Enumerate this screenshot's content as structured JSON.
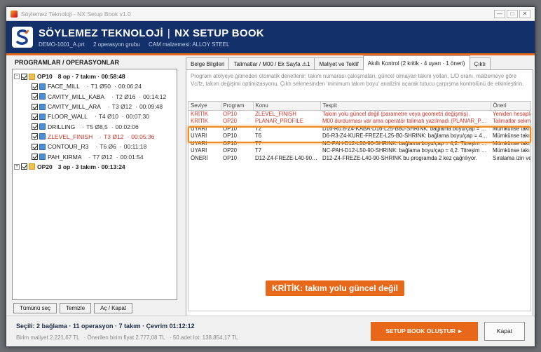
{
  "window": {
    "title": "Söylemez Teknoloji - NX Setup Book v1.0",
    "controls": {
      "minimize": "—",
      "maximize": "□",
      "close": "✕"
    }
  },
  "header": {
    "company": "SÖYLEMEZ TEKNOLOJİ",
    "separator": "|",
    "product": "NX SETUP BOOK",
    "file": "DEMO-1001_A.prt",
    "groups": "2 operasyon grubu",
    "material": "CAM malzemesi: ALLOY STEEL",
    "colors": {
      "header_bg": "#14306a",
      "accent": "#e8681a"
    }
  },
  "left": {
    "title": "PROGRAMLAR / OPERASYONLAR",
    "groups": [
      {
        "expander": "-",
        "name": "OP10",
        "summary": "8 op · 7 takım · 00:58:48",
        "ops": [
          {
            "name": "FACE_MILL",
            "tool": "T1 Ø50",
            "time": "00:06:24",
            "warn": false
          },
          {
            "name": "CAVITY_MILL_KABA",
            "tool": "T2 Ø16",
            "time": "00:14:12",
            "warn": false
          },
          {
            "name": "CAVITY_MILL_ARA",
            "tool": "T3 Ø12",
            "time": "00:09:48",
            "warn": false
          },
          {
            "name": "FLOOR_WALL",
            "tool": "T4 Ø10",
            "time": "00:07:30",
            "warn": false
          },
          {
            "name": "DRILLING",
            "tool": "T5 Ø8,5",
            "time": "00:02:06",
            "warn": false
          },
          {
            "name": "ZLEVEL_FINISH",
            "tool": "T3 Ø12",
            "time": "00:05:36",
            "warn": true
          },
          {
            "name": "CONTOUR_R3",
            "tool": "T6 Ø6",
            "time": "00:11:18",
            "warn": false
          },
          {
            "name": "PAH_KIRMA",
            "tool": "T7 Ø12",
            "time": "00:01:54",
            "warn": false
          }
        ]
      },
      {
        "expander": "+",
        "name": "OP20",
        "summary": "3 op · 3 takım · 00:13:24",
        "ops": []
      }
    ],
    "buttons": {
      "select_all": "Tümünü seç",
      "clear": "Temizle",
      "toggle": "Aç / Kapat"
    }
  },
  "tabs": [
    {
      "label": "Belge Bilgileri",
      "active": false
    },
    {
      "label": "Talimatlar / M00 / Ek Sayfa ⚠1",
      "active": false
    },
    {
      "label": "Maliyet ve Teklif",
      "active": false
    },
    {
      "label": "Akıllı Kontrol  (2 kritik · 4 uyarı · 1 öneri)",
      "active": true
    },
    {
      "label": "Çıktı",
      "active": false
    }
  ],
  "check": {
    "description": "Program atölyeye gitmeden otomatik denetlenir: takım numarası çakışmaları, güncel olmayan takım yolları, L/D oranı, malzemeye göre Vc/fz, takım değişimi optimizasyonu. Çıktı sekmesinden 'minimum takım boyu' analizini açarak tutucu çarpışma kontrolünü de etkinleştirin.",
    "columns": [
      "Seviye",
      "Program",
      "Konu",
      "Tespit",
      "Öneri"
    ],
    "rows": [
      {
        "level": "KRİTİK",
        "program": "OP10",
        "topic": "ZLEVEL_FINISH",
        "finding": "Takım yolu güncel değil (parametre veya geometri değişmiş).",
        "suggestion": "Yeniden hesapla",
        "kritik": true
      },
      {
        "level": "KRİTİK",
        "program": "OP20",
        "topic": "PLANAR_PROFILE",
        "finding": "M00 durdurması var ama operatör talimatı yazılmadı (PLANAR_PRO...",
        "suggestion": "Talimatlar sekmesi",
        "kritik": true
      },
      {
        "level": "UYARI",
        "program": "OP10",
        "topic": "T2",
        "finding": "D16-R0.8-Z4-KABA-D16-L25-B80-SHRINK: bağlama boyu/çap = 4,1. Ti...",
        "suggestion": "Mümkünse takı",
        "kritik": false
      },
      {
        "level": "UYARI",
        "program": "OP10",
        "topic": "T6",
        "finding": "D6-R3-Z4-KURE-FREZE-L25-B0-SHRINK: bağlama boyu/çap = 4,2. Ti...",
        "suggestion": "Mümkünse takı",
        "kritik": false
      },
      {
        "level": "UYARI",
        "program": "OP10",
        "topic": "T7",
        "finding": "NC-PAH-D12-L50-90-SHRINK: bağlama boyu/çap = 4,2. Titreşim ris...",
        "suggestion": "Mümkünse takı",
        "kritik": false
      },
      {
        "level": "UYARI",
        "program": "OP20",
        "topic": "T7",
        "finding": "NC-PAH-D12-L50-90-SHRINK: bağlama boyu/çap = 4,2. Titreşim ris...",
        "suggestion": "Mümkünse takı",
        "kritik": false
      },
      {
        "level": "ÖNERİ",
        "program": "OP10",
        "topic": "D12-Z4-FREZE-L40-90-S...",
        "finding": "D12-Z4-FREZE-L40-90-SHRINK bu programda 2 kez çağrılıyor.",
        "suggestion": "Sıralama izin ve",
        "kritik": false
      }
    ],
    "callout": "KRİTİK: takım yolu güncel değil"
  },
  "footer": {
    "summary": "Seçili: 2 bağlama · 11 operasyon · 7 takım · Çevrim 01:12:12",
    "unit_cost": "Birim maliyet 2.221,67 TL",
    "recommended_price": "Önerilen birim fiyat 2.777,08 TL",
    "lot_total": "50 adet lot: 138.854,17 TL",
    "create_button": "SETUP BOOK OLUŞTUR  ►",
    "close_button": "Kapat"
  }
}
